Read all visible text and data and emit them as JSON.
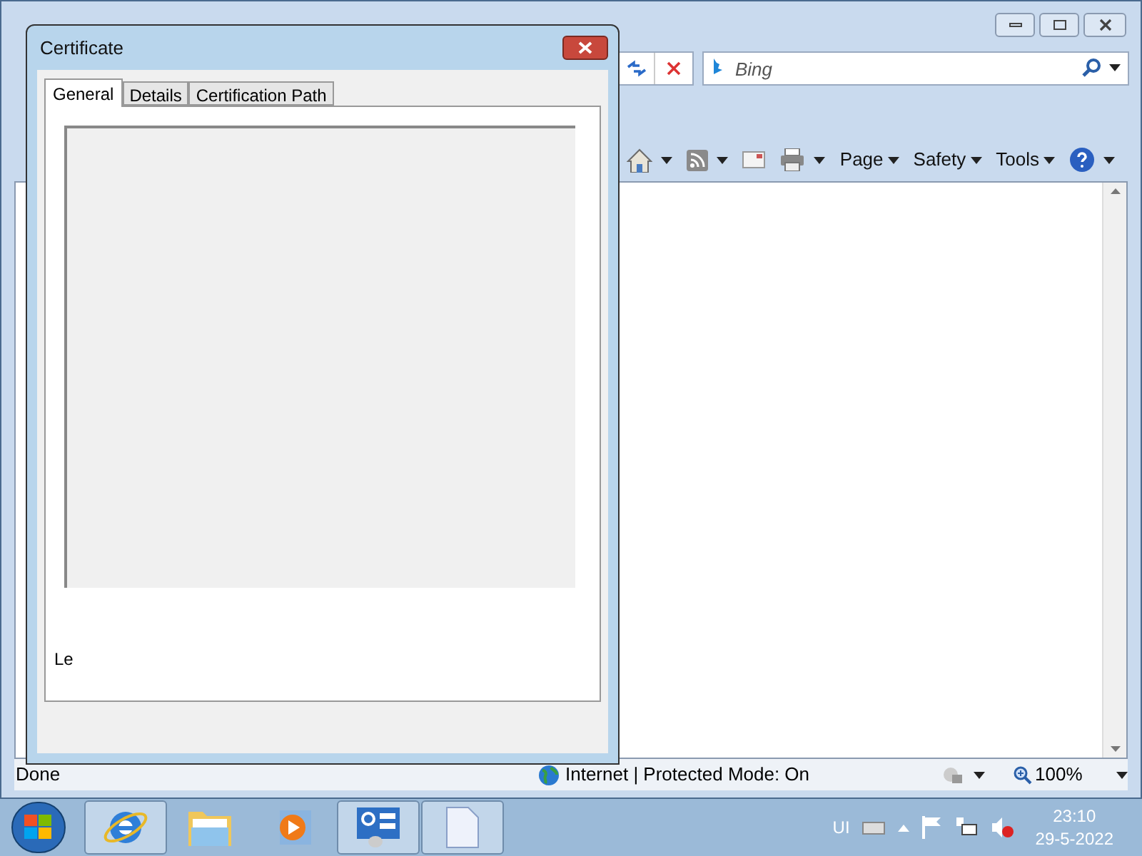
{
  "browser": {
    "search": {
      "placeholder": "Bing"
    },
    "command_bar": [
      {
        "kind": "icon",
        "dropdown": true
      },
      {
        "kind": "icon",
        "dropdown": true
      },
      {
        "kind": "icon",
        "dropdown": false
      },
      {
        "kind": "icon",
        "dropdown": true
      },
      {
        "kind": "menu",
        "label": "Page"
      },
      {
        "kind": "menu",
        "label": "Safety"
      },
      {
        "kind": "menu",
        "label": "Tools"
      },
      {
        "kind": "icon",
        "dropdown": true
      }
    ],
    "status_bar": {
      "status": "Done",
      "zone": "Internet | Protected Mode: On",
      "zoom": "100%"
    }
  },
  "dialog": {
    "title": "Certificate",
    "tabs": [
      {
        "label": "General",
        "selected": true
      },
      {
        "label": "Details",
        "selected": false
      },
      {
        "label": "Certification Path",
        "selected": false
      }
    ],
    "cut_text": "Le"
  },
  "taskbar": {
    "apps": [
      {
        "open": true
      },
      {
        "open": false
      },
      {
        "open": false
      },
      {
        "open": true
      },
      {
        "open": true
      }
    ],
    "tray": {
      "language": "UI",
      "time": "23:10",
      "date": "29-5-2022"
    }
  }
}
